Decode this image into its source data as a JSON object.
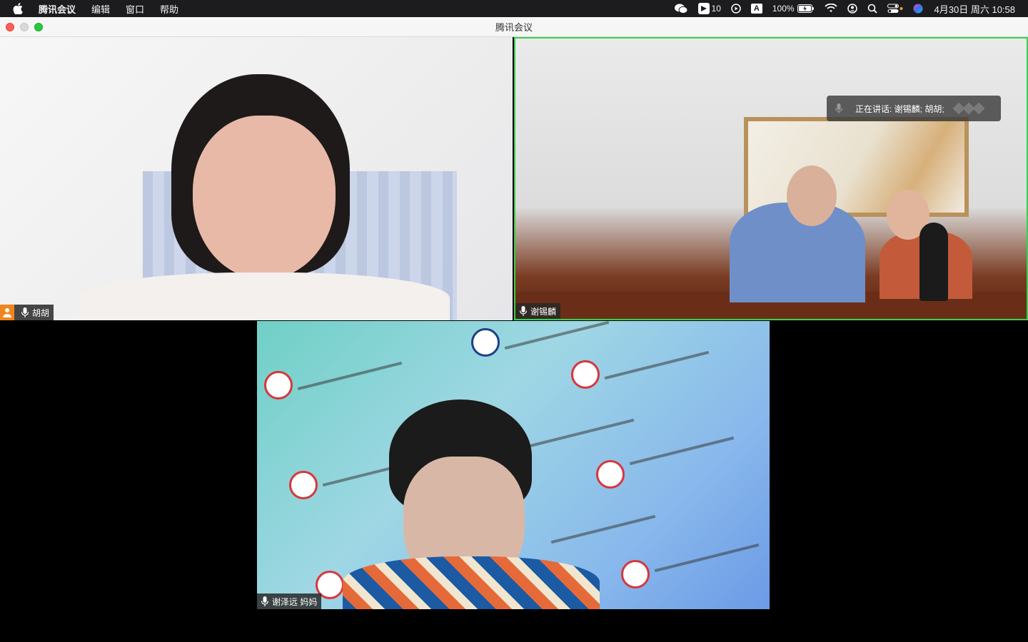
{
  "menubar": {
    "app_name": "腾讯会议",
    "menus": [
      "编辑",
      "窗口",
      "帮助"
    ],
    "status": {
      "notification_count": "10",
      "input_method": "A",
      "battery": "100%",
      "datetime": "4月30日 周六  10:58"
    }
  },
  "window": {
    "title": "腾讯会议"
  },
  "participants": [
    {
      "name": "胡胡",
      "is_host": true
    },
    {
      "name": "谢锡麟",
      "is_host": false
    },
    {
      "name": "谢泽远 妈妈",
      "is_host": false
    }
  ],
  "speaking": {
    "label": "正在讲话: 谢锡麟; 胡胡;"
  },
  "colors": {
    "active_speaker_border": "#3ccf4e",
    "host_badge": "#f0851c"
  }
}
